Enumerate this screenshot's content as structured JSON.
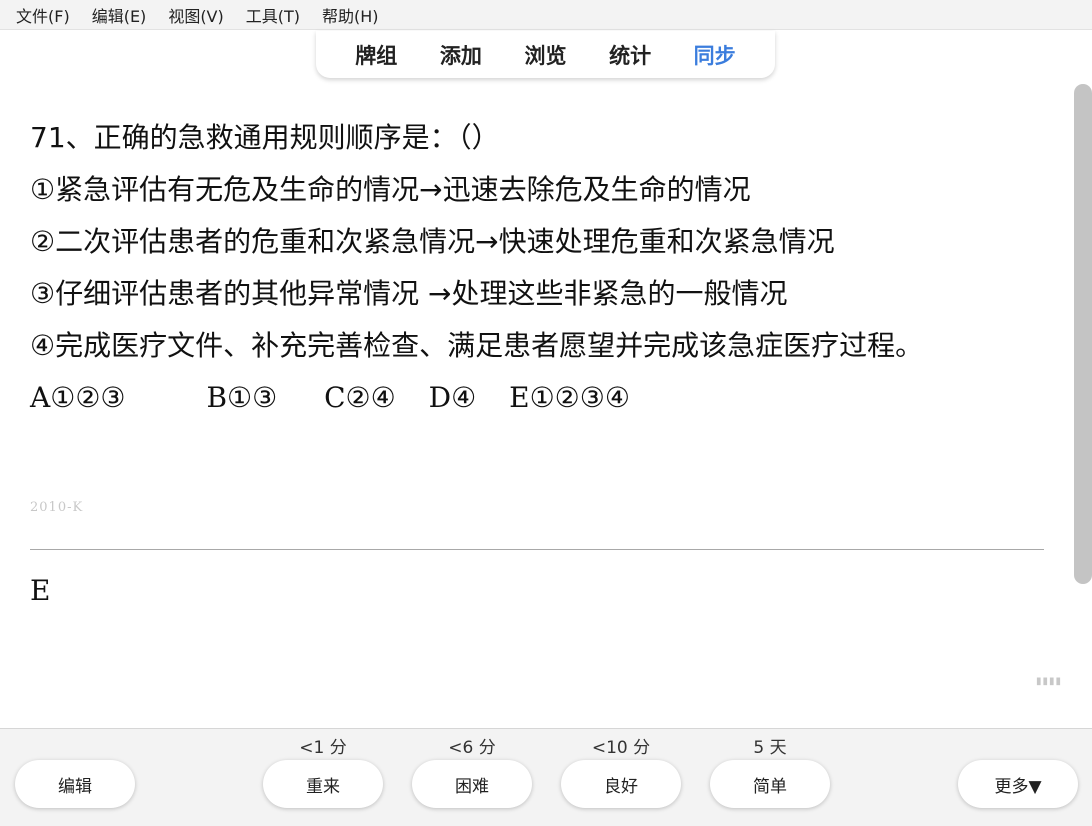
{
  "menu": [
    "文件(F)",
    "编辑(E)",
    "视图(V)",
    "工具(T)",
    "帮助(H)"
  ],
  "tabs": [
    "牌组",
    "添加",
    "浏览",
    "统计",
    "同步"
  ],
  "active_tab": "同步",
  "question": {
    "stem": "71、正确的急救通用规则顺序是：（）",
    "items": [
      "①紧急评估有无危及生命的情况→迅速去除危及生命的情况",
      "②二次评估患者的危重和次紧急情况→快速处理危重和次紧急情况",
      "③仔细评估患者的其他异常情况 →处理这些非紧急的一般情况",
      "④完成医疗文件、补充完善检查、满足患者愿望并完成该急症医疗过程。"
    ],
    "options": [
      "A①②③",
      "B①③",
      "C②④",
      "D④",
      "E①②③④"
    ],
    "tag": "2010-K"
  },
  "answer": "E",
  "bottom": {
    "edit_label": "编辑",
    "more_label": "更多▼",
    "buttons": [
      {
        "label": "重来",
        "interval": "<1 分"
      },
      {
        "label": "困难",
        "interval": "<6 分"
      },
      {
        "label": "良好",
        "interval": "<10 分"
      },
      {
        "label": "简单",
        "interval": "5 天"
      }
    ]
  },
  "colors": {
    "accent": "#3b7ddd",
    "bar_background": "#f3f3f3"
  }
}
